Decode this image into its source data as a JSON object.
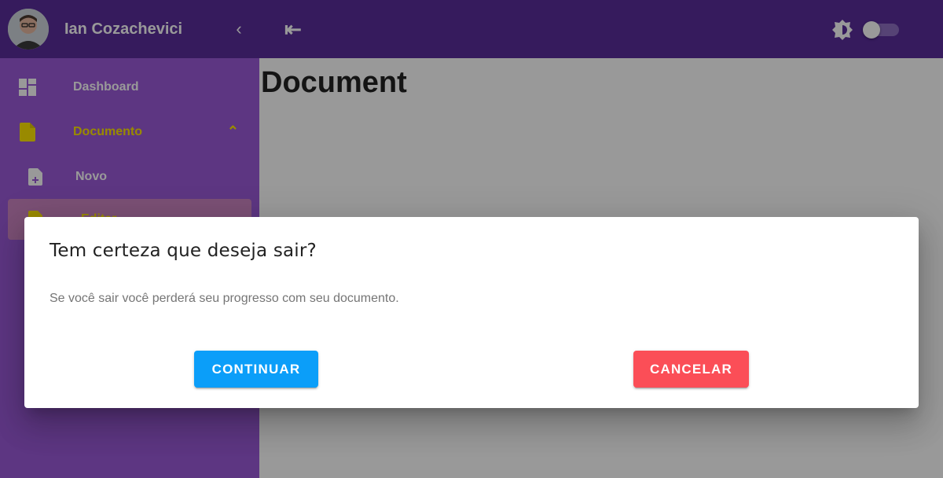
{
  "sidebar": {
    "user_name": "Ian Cozachevici",
    "collapse_icon": "chevron-left-icon",
    "items": [
      {
        "label": "Dashboard",
        "icon": "dashboard-icon"
      },
      {
        "label": "Documento",
        "icon": "document-icon",
        "expanded": true
      },
      {
        "label": "Novo",
        "icon": "document-add-icon"
      },
      {
        "label": "Editar",
        "icon": "document-edit-icon",
        "active": true
      }
    ]
  },
  "topbar": {
    "menu_icon": "menu-collapse-icon",
    "theme_icon": "brightness-icon",
    "theme_toggle_on": false
  },
  "main": {
    "title": "Document"
  },
  "dialog": {
    "title": "Tem certeza que deseja sair?",
    "text": "Se você sair você perderá seu progresso com seu documento.",
    "continue_label": "CONTINUAR",
    "cancel_label": "CANCELAR"
  },
  "colors": {
    "header_bg": "#5a2d9c",
    "sidebar_bg": "#9c5ad9",
    "active_text": "#ffe600",
    "continue_button": "#0b9ef9",
    "cancel_button": "#fb4e57"
  }
}
